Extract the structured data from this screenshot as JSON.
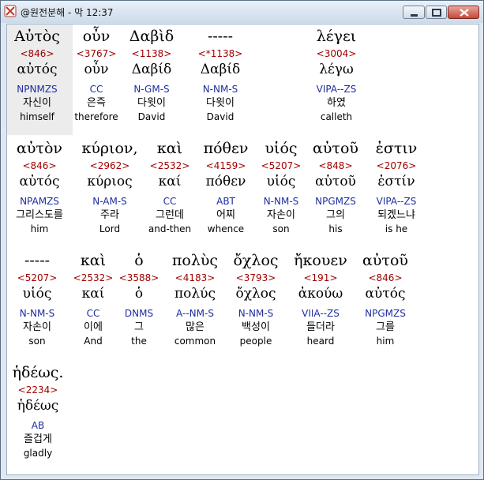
{
  "window": {
    "title": "@원전분해 - 막 12:37"
  },
  "words": [
    {
      "greek": "Αὐτὸς",
      "strong": "<846>",
      "lemma": "αὐτός",
      "parse": "NPNMZS",
      "korean": "자신이",
      "english": "himself"
    },
    {
      "greek": "οὖν",
      "strong": "<3767>",
      "lemma": "οὖν",
      "parse": "CC",
      "korean": "은즉",
      "english": "therefore"
    },
    {
      "greek": "Δαβὶδ",
      "strong": "<1138>",
      "lemma": "Δαβίδ",
      "parse": "N-GM-S",
      "korean": "다윗이",
      "english": "David"
    },
    {
      "greek": "-----",
      "strong": "<*1138>",
      "lemma": "Δαβίδ",
      "parse": "N-NM-S",
      "korean": "다윗이",
      "english": "David"
    },
    {
      "greek": "λέγει",
      "strong": "<3004>",
      "lemma": "λέγω",
      "parse": "VIPA--ZS",
      "korean": "하였",
      "english": "calleth"
    },
    {
      "greek": "αὐτὸν",
      "strong": "<846>",
      "lemma": "αὐτός",
      "parse": "NPAMZS",
      "korean": "그리스도를",
      "english": "him"
    },
    {
      "greek": "κύριον,",
      "strong": "<2962>",
      "lemma": "κύριος",
      "parse": "N-AM-S",
      "korean": "주라",
      "english": "Lord"
    },
    {
      "greek": "καὶ",
      "strong": "<2532>",
      "lemma": "καί",
      "parse": "CC",
      "korean": "그런데",
      "english": "and-then"
    },
    {
      "greek": "πόθεν",
      "strong": "<4159>",
      "lemma": "πόθεν",
      "parse": "ABT",
      "korean": "어찌",
      "english": "whence"
    },
    {
      "greek": "υἱός",
      "strong": "<5207>",
      "lemma": "υἱός",
      "parse": "N-NM-S",
      "korean": "자손이",
      "english": "son"
    },
    {
      "greek": "αὐτοῦ",
      "strong": "<848>",
      "lemma": "αὑτοῦ",
      "parse": "NPGMZS",
      "korean": "그의",
      "english": "his"
    },
    {
      "greek": "ἐστιν",
      "strong": "<2076>",
      "lemma": "ἐστίν",
      "parse": "VIPA--ZS",
      "korean": "되겠느냐",
      "english": "is he"
    },
    {
      "greek": "-----",
      "strong": "<5207>",
      "lemma": "υἱός",
      "parse": "N-NM-S",
      "korean": "자손이",
      "english": "son"
    },
    {
      "greek": "καὶ",
      "strong": "<2532>",
      "lemma": "καί",
      "parse": "CC",
      "korean": "이에",
      "english": "And"
    },
    {
      "greek": "ὁ",
      "strong": "<3588>",
      "lemma": "ὁ",
      "parse": "DNMS",
      "korean": "그",
      "english": "the"
    },
    {
      "greek": "πολὺς",
      "strong": "<4183>",
      "lemma": "πολύς",
      "parse": "A--NM-S",
      "korean": "많은",
      "english": "common"
    },
    {
      "greek": "ὄχλος",
      "strong": "<3793>",
      "lemma": "ὄχλος",
      "parse": "N-NM-S",
      "korean": "백성이",
      "english": "people"
    },
    {
      "greek": "ἤκουεν",
      "strong": "<191>",
      "lemma": "ἀκούω",
      "parse": "VIIA--ZS",
      "korean": "들더라",
      "english": "heard"
    },
    {
      "greek": "αὐτοῦ",
      "strong": "<846>",
      "lemma": "αὐτός",
      "parse": "NPGMZS",
      "korean": "그를",
      "english": "him"
    },
    {
      "greek": "ἡδέως.",
      "strong": "<2234>",
      "lemma": "ἡδέως",
      "parse": "AB",
      "korean": "즐겁게",
      "english": "gladly"
    }
  ]
}
